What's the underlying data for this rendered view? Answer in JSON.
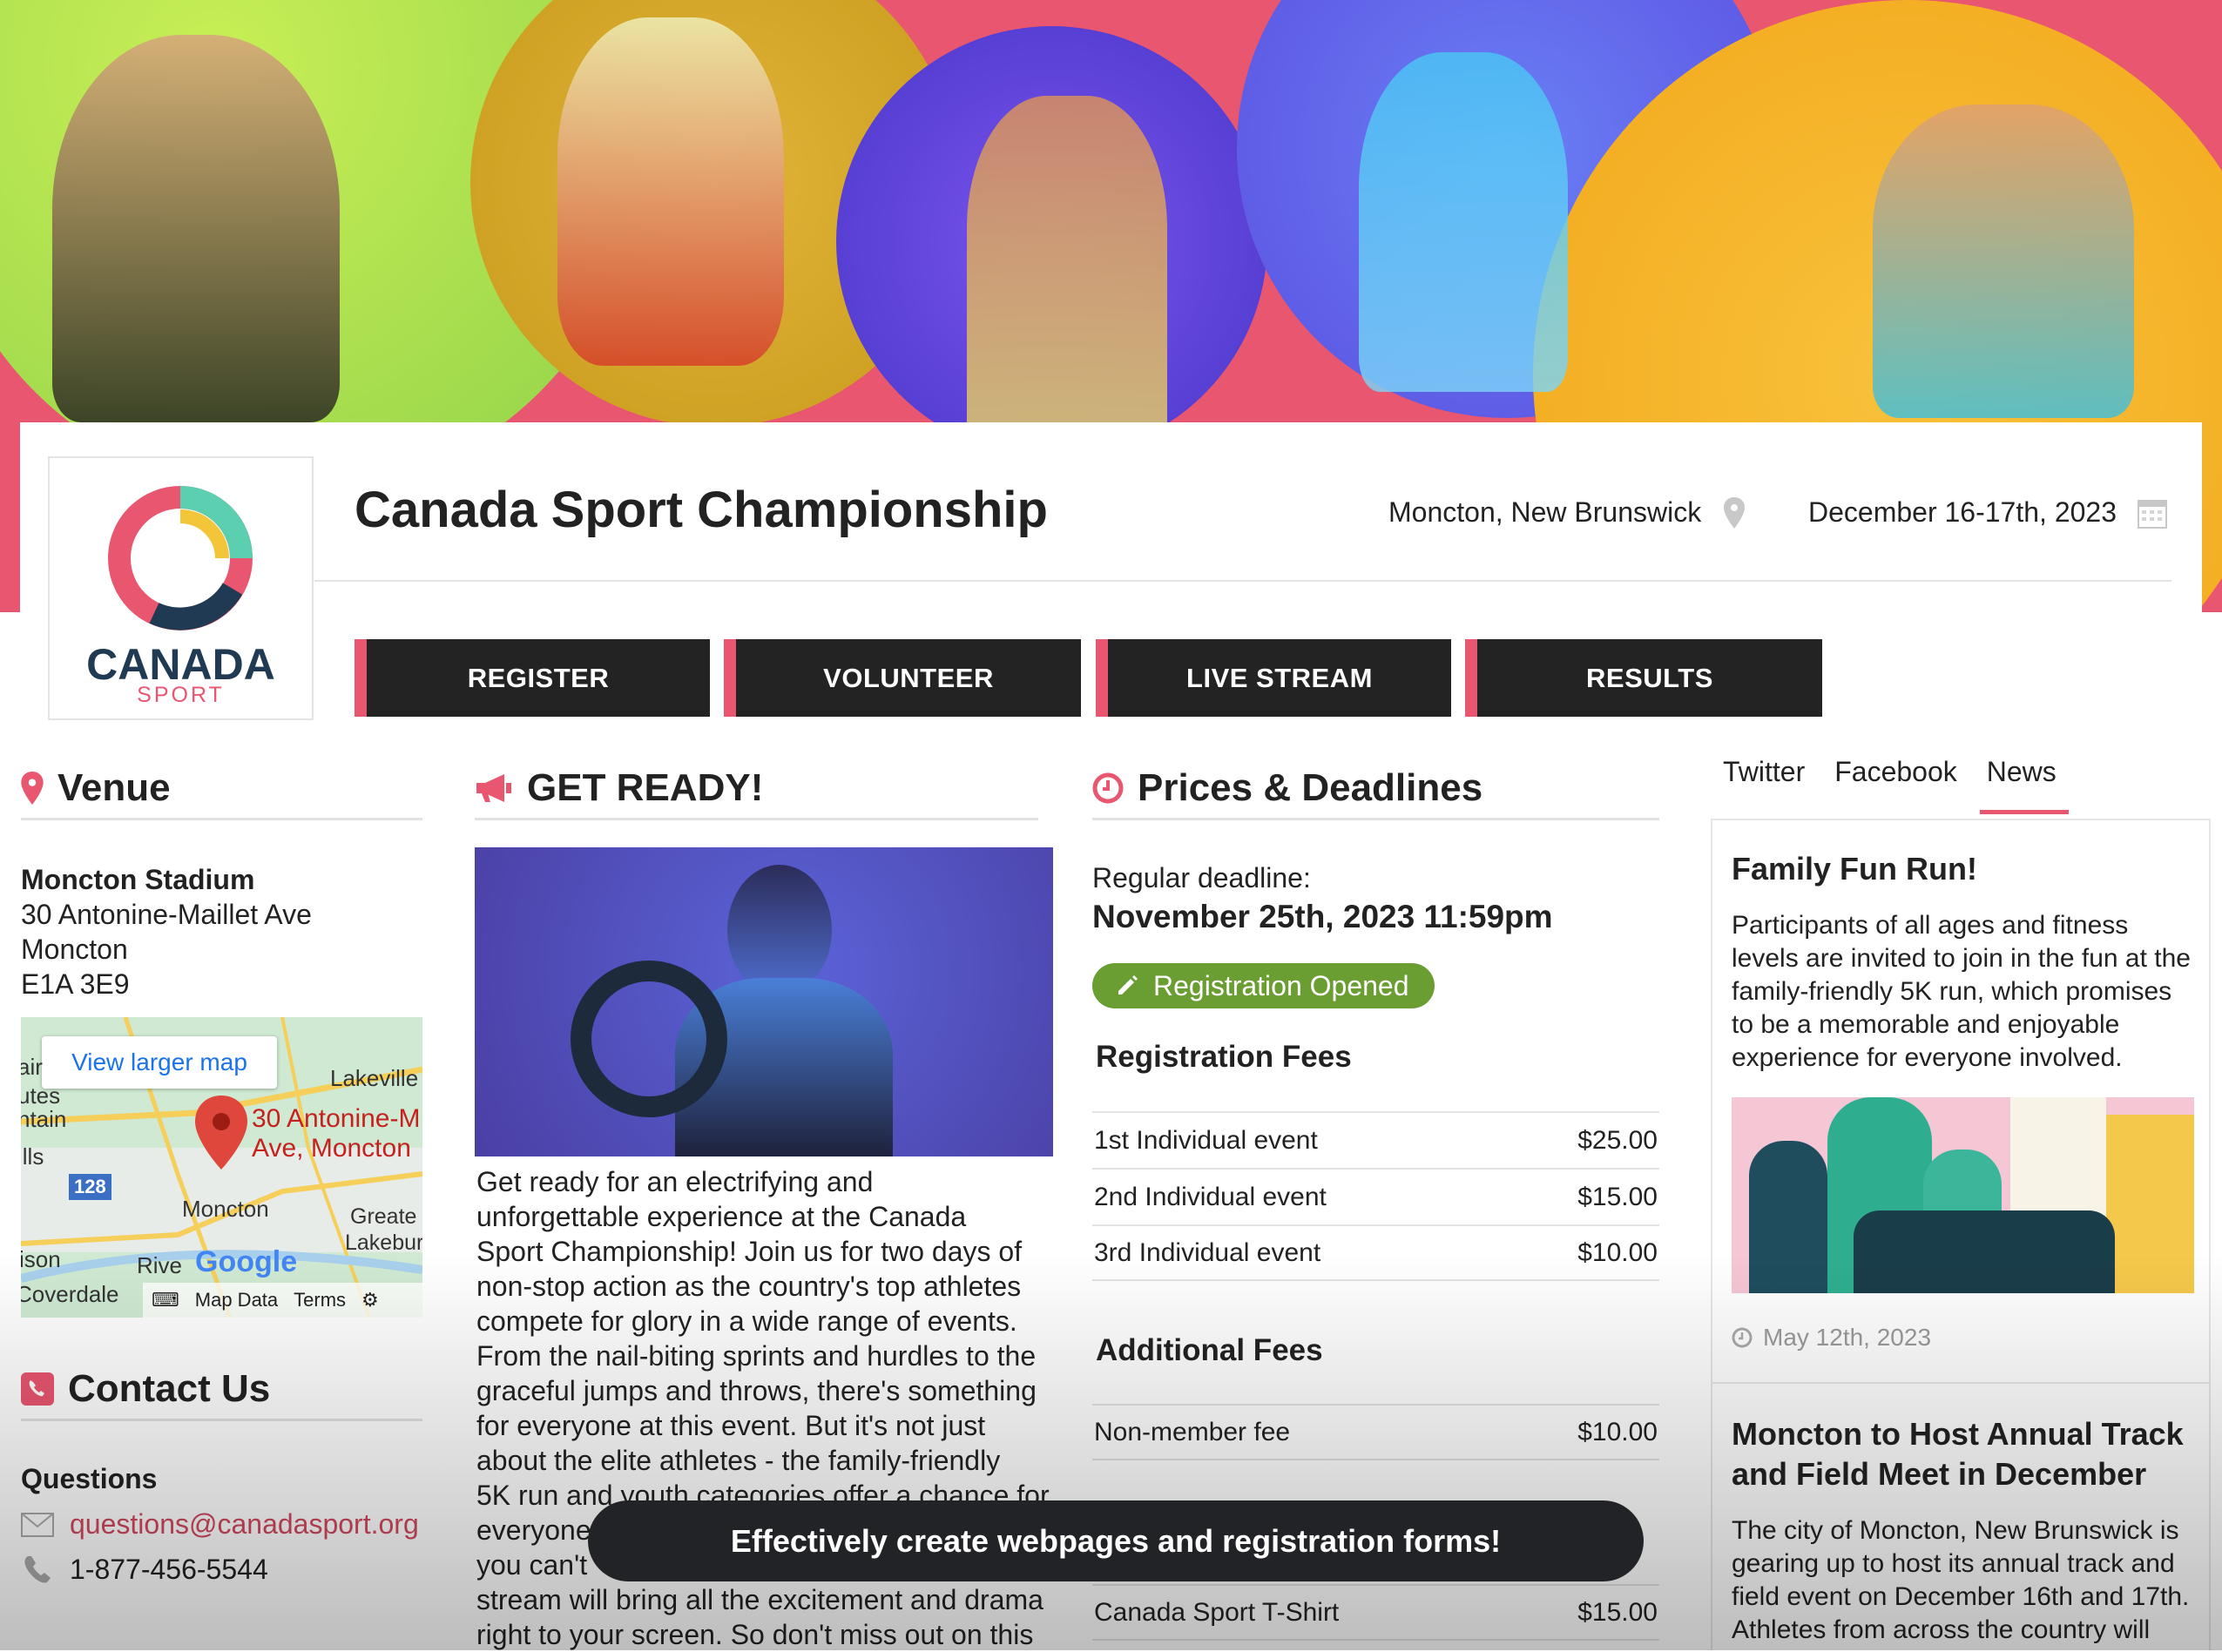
{
  "header": {
    "title": "Canada Sport Championship",
    "location": "Moncton, New Brunswick",
    "date": "December 16-17th, 2023",
    "location_icon": "map-pin-icon",
    "date_icon": "calendar-icon"
  },
  "logo": {
    "word": "CANADA",
    "sub": "SPORT"
  },
  "nav": [
    {
      "label": "REGISTER"
    },
    {
      "label": "VOLUNTEER"
    },
    {
      "label": "LIVE STREAM"
    },
    {
      "label": "RESULTS"
    }
  ],
  "venue": {
    "heading": "Venue",
    "name": "Moncton Stadium",
    "address": [
      "30 Antonine-Maillet Ave",
      "Moncton",
      "E1A 3E9"
    ],
    "map": {
      "link": "View larger map",
      "pin_label": [
        "30 Antonine-M",
        "Ave, Moncton"
      ],
      "places": [
        "Lakeville",
        "Moncton",
        "Greate",
        "Lakebur",
        "ison",
        "Coverdale",
        "ntain",
        "ills",
        "utes",
        "air",
        "Rive"
      ],
      "route": "128",
      "attribution": [
        "Map Data",
        "Terms"
      ],
      "brand": "Google"
    }
  },
  "contact": {
    "heading": "Contact Us",
    "subheading": "Questions",
    "email": "questions@canadasport.org",
    "phone": "1-877-456-5544"
  },
  "get_ready": {
    "heading": "GET READY!",
    "lines": [
      "Get ready for an electrifying and",
      "unforgettable experience at the Canada",
      "Sport Championship! Join us for two days of",
      "non-stop action as the country's top athletes",
      "compete for glory in a wide range of events.",
      "From the nail-biting sprints and hurdles to the",
      "graceful jumps and throws, there's something",
      "for everyone at this event. But it's not just",
      "about the elite athletes - the family-friendly",
      "5K run and youth categories offer a chance for",
      "everyone",
      "you can't",
      "stream will bring all the excitement and drama",
      "right to your screen. So don't miss out on this"
    ]
  },
  "prices": {
    "heading": "Prices & Deadlines",
    "deadline_label": "Regular deadline:",
    "deadline": "November 25th, 2023 11:59pm",
    "status": "Registration Opened",
    "status_color": "#6a9e32",
    "registration_heading": "Registration Fees",
    "registration_fees": [
      {
        "name": "1st Individual event",
        "price": "$25.00"
      },
      {
        "name": "2nd Individual event",
        "price": "$15.00"
      },
      {
        "name": "3rd Individual event",
        "price": "$10.00"
      }
    ],
    "additional_heading": "Additional Fees",
    "additional_fees": [
      {
        "name": "Non-member fee",
        "price": "$10.00"
      },
      {
        "name": "Canada Sport T-Shirt",
        "price": "$15.00"
      }
    ]
  },
  "news": {
    "tabs": [
      {
        "label": "Twitter"
      },
      {
        "label": "Facebook"
      },
      {
        "label": "News",
        "active": true
      }
    ],
    "items": [
      {
        "title": "Family Fun Run!",
        "body": "Participants of all ages and fitness levels are invited to join in the fun at the family-friendly 5K run, which promises to be a memorable and enjoyable experience for everyone involved.",
        "date": "May 12th, 2023"
      },
      {
        "title": "Moncton to Host Annual Track and Field Meet in December",
        "body": "The city of Moncton, New Brunswick is gearing up to host its annual track and field event on December 16th and 17th. Athletes from across the country will"
      }
    ]
  },
  "promo": {
    "text": "Effectively create webpages and registration forms!"
  },
  "colors": {
    "accent": "#e9566f",
    "dark": "#232323",
    "green": "#6a9e32"
  }
}
